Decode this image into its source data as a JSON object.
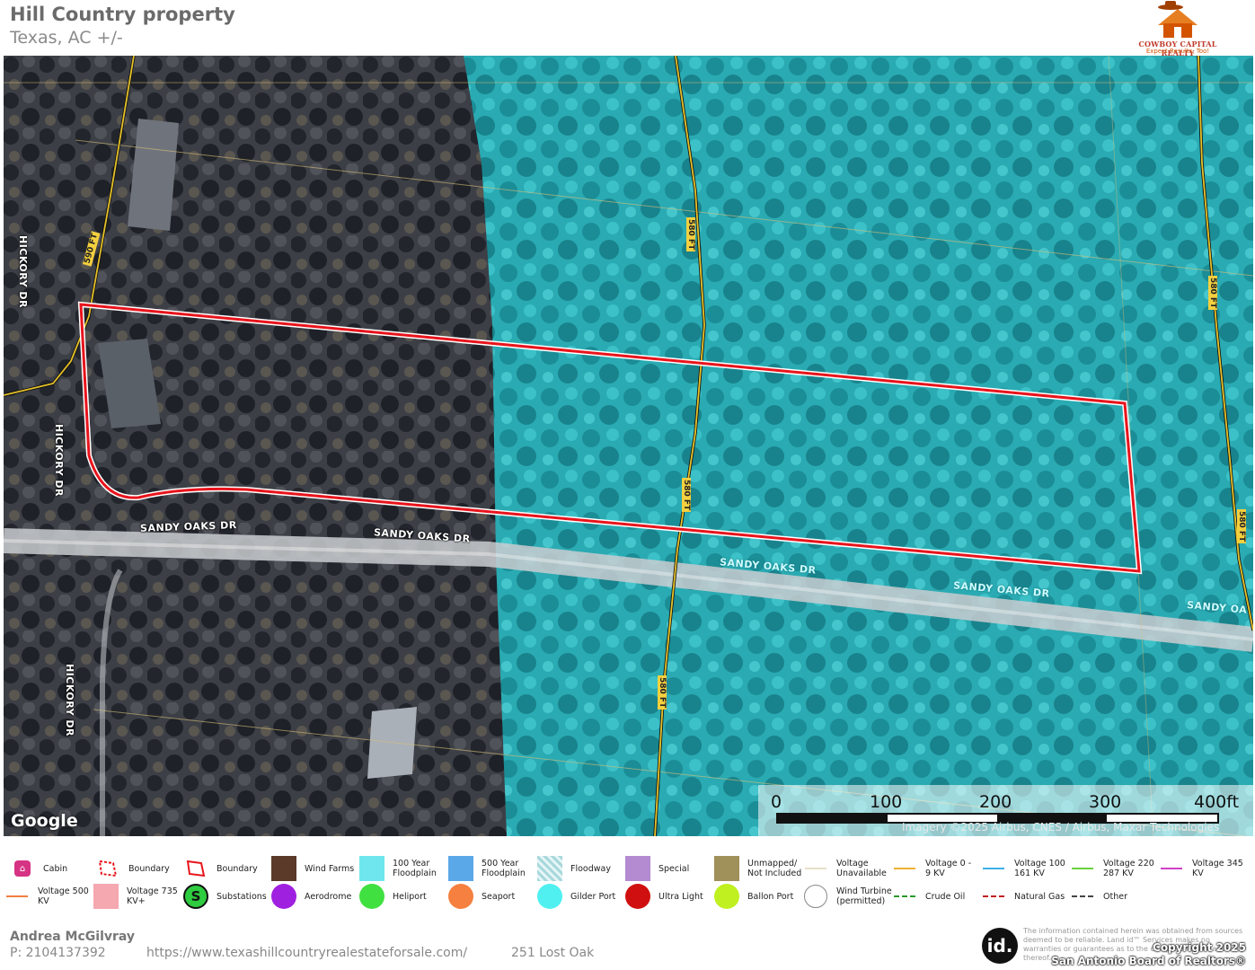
{
  "header": {
    "title": "Hill Country property",
    "subtitle": "Texas,  AC +/-",
    "logo_text": "COWBOY CAPITAL REALTY",
    "logo_tagline": "Expect Results, Too!"
  },
  "map": {
    "road_labels": [
      "HICKORY DR",
      "HICKORY DR",
      "HICKORY DR",
      "SANDY OAKS DR",
      "SANDY OAKS DR",
      "SANDY OAKS DR",
      "SANDY OAKS DR",
      "SANDY OA"
    ],
    "contour_labels": [
      "590 FT",
      "580 FT",
      "580 FT",
      "580 FT",
      "580 FT",
      "580 FT"
    ],
    "google_label": "Google",
    "imagery_credit": "Imagery ©2025 Airbus, CNES / Airbus, Maxar Technologies",
    "scale": {
      "labels": [
        "0",
        "100",
        "200",
        "300",
        "400ft"
      ]
    },
    "colors": {
      "boundary": "#e8141c",
      "floodplain": "#1fb5c0",
      "contour": "#e6c229"
    }
  },
  "legend": {
    "items": [
      {
        "label": "Cabin",
        "icon": "cabin-icon"
      },
      {
        "label": "Boundary",
        "icon": "boundary-dashed-icon"
      },
      {
        "label": "Boundary",
        "icon": "boundary-icon"
      },
      {
        "label": "Wind Farms",
        "icon": "wind-farms-swatch"
      },
      {
        "label": "100 Year Floodplain",
        "icon": "floodplain-100-swatch"
      },
      {
        "label": "500 Year Floodplain",
        "icon": "floodplain-500-swatch"
      },
      {
        "label": "Floodway",
        "icon": "floodway-swatch"
      },
      {
        "label": "Special",
        "icon": "special-swatch"
      },
      {
        "label": "Unmapped/ Not Included",
        "icon": "unmapped-swatch"
      },
      {
        "label": "Voltage Unavailable",
        "icon": "voltage-unavailable-line"
      },
      {
        "label": "Voltage 0 - 9 KV",
        "icon": "voltage-0-9-line"
      },
      {
        "label": "Voltage 100 161 KV",
        "icon": "voltage-100-161-line"
      },
      {
        "label": "Voltage 220 287 KV",
        "icon": "voltage-220-287-line"
      },
      {
        "label": "Voltage 345 KV",
        "icon": "voltage-345-line"
      },
      {
        "label": "Voltage 500 KV",
        "icon": "voltage-500-line"
      },
      {
        "label": "Voltage  735 KV+",
        "icon": "voltage-735-swatch"
      },
      {
        "label": "Substations",
        "icon": "substation-icon"
      },
      {
        "label": "Aerodrome",
        "icon": "aerodrome-icon"
      },
      {
        "label": "Heliport",
        "icon": "heliport-icon"
      },
      {
        "label": "Seaport",
        "icon": "seaport-icon"
      },
      {
        "label": "Gilder Port",
        "icon": "glider-port-icon"
      },
      {
        "label": "Ultra Light",
        "icon": "ultra-light-icon"
      },
      {
        "label": "Ballon Port",
        "icon": "balloon-port-icon"
      },
      {
        "label": "Wind Turbine (permitted)",
        "icon": "wind-turbine-icon"
      },
      {
        "label": "Crude Oil",
        "icon": "crude-oil-line"
      },
      {
        "label": "Natural Gas",
        "icon": "natural-gas-line"
      },
      {
        "label": "Other",
        "icon": "other-line"
      }
    ]
  },
  "footer": {
    "agent": "Andrea McGilvray",
    "phone": "P: 2104137392",
    "url": "https://www.texashillcountryrealestateforsale.com/",
    "address": "251 Lost Oak",
    "id_logo": "id.",
    "disclaimer": "The information contained herein was obtained from sources deemed to be reliable. Land id™ Services makes no warranties or guarantees as to the completeness or accuracy thereof.",
    "copyright_line1": "Copyright 2025",
    "copyright_line2": "San Antonio Board of Realtors®"
  }
}
